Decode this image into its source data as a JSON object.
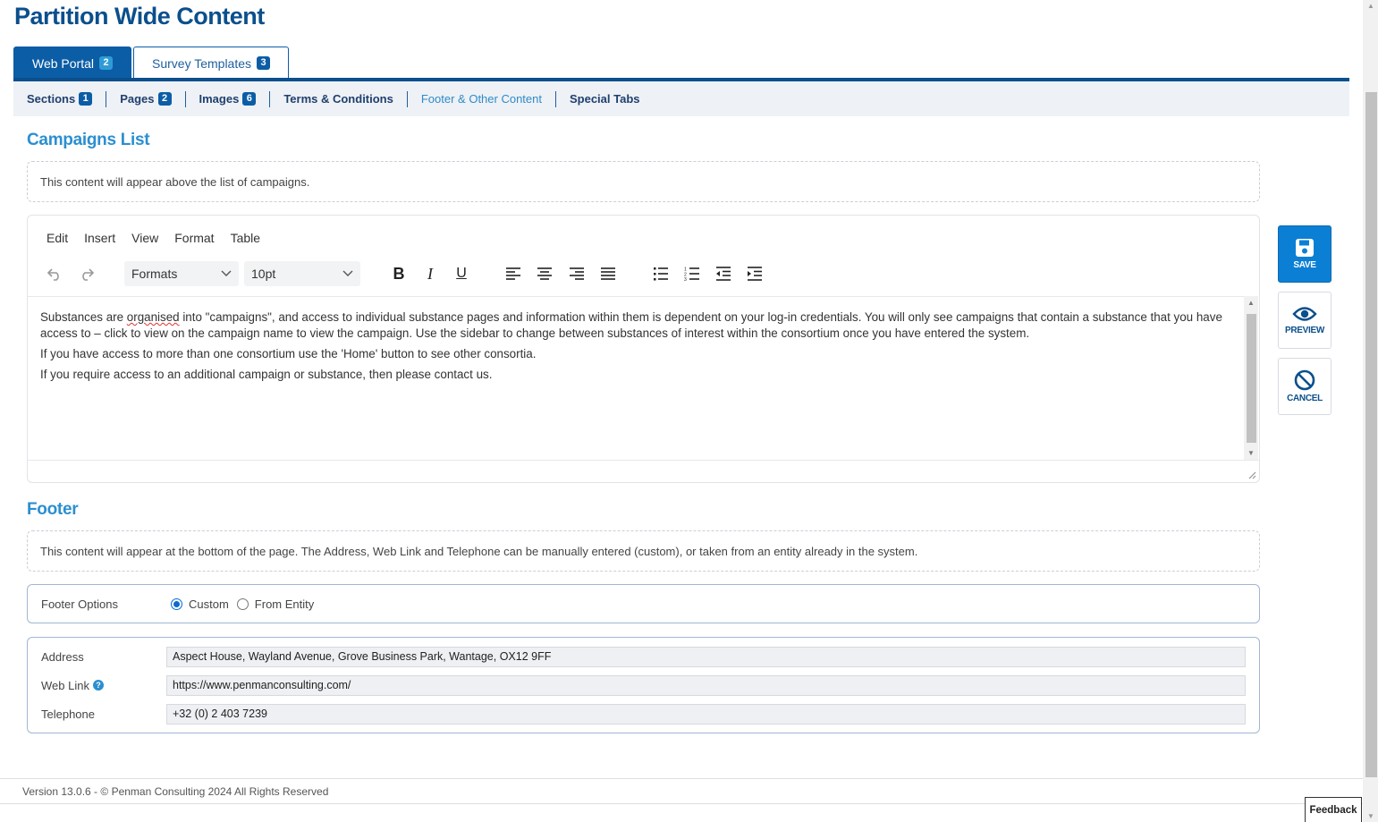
{
  "page": {
    "title": "Partition Wide Content"
  },
  "main_tabs": [
    {
      "label": "Web Portal",
      "badge": "2",
      "active": true
    },
    {
      "label": "Survey Templates",
      "badge": "3",
      "active": false
    }
  ],
  "sub_tabs": [
    {
      "label": "Sections",
      "badge": "1"
    },
    {
      "label": "Pages",
      "badge": "2"
    },
    {
      "label": "Images",
      "badge": "6"
    },
    {
      "label": "Terms & Conditions"
    },
    {
      "label": "Footer & Other Content",
      "current": true
    },
    {
      "label": "Special Tabs"
    }
  ],
  "campaigns": {
    "title": "Campaigns List",
    "info": "This content will appear above the list of campaigns."
  },
  "editor": {
    "menu": [
      "Edit",
      "Insert",
      "View",
      "Format",
      "Table"
    ],
    "formats_label": "Formats",
    "font_size": "10pt",
    "content": {
      "p1_before": "Substances are ",
      "p1_misspelled": "organised",
      "p1_after": " into \"campaigns\", and access to individual substance pages and information within them is dependent on your log-in credentials. You will only see campaigns that contain a substance that you have access to – click to view on the campaign name to view the campaign. Use the sidebar to change between substances of interest within the consortium once you have entered the system.",
      "p2": "If you have access to more than one consortium use the 'Home' button to see other consortia.",
      "p3": "If you require access to an additional campaign or substance, then please contact us."
    }
  },
  "actions": {
    "save": "SAVE",
    "preview": "PREVIEW",
    "cancel": "CANCEL"
  },
  "footer_section": {
    "title": "Footer",
    "info": "This content will appear at the bottom of the page. The Address, Web Link and Telephone can be manually entered (custom), or taken from an entity already in the system.",
    "options_label": "Footer Options",
    "option_custom": "Custom",
    "option_entity": "From Entity",
    "selected_option": "Custom",
    "address_label": "Address",
    "address_value": "Aspect House, Wayland Avenue, Grove Business Park, Wantage, OX12 9FF",
    "weblink_label": "Web Link",
    "weblink_value": "https://www.penmanconsulting.com/",
    "telephone_label": "Telephone",
    "telephone_value": "+32 (0) 2 403 7239"
  },
  "page_footer": {
    "version": "Version 13.0.6 - © Penman Consulting 2024 All Rights Reserved",
    "feedback": "Feedback"
  },
  "colors": {
    "primary": "#0b4f8c",
    "accent": "#2b8fd0",
    "save": "#0b7fd4"
  }
}
